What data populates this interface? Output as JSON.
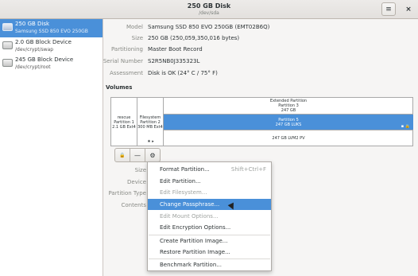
{
  "window": {
    "title": "250 GB Disk",
    "subtitle": "/dev/sda",
    "menu_icon": "hamburger-menu-icon",
    "close_icon": "close-icon"
  },
  "sidebar": {
    "items": [
      {
        "name": "250 GB Disk",
        "sub": "Samsung SSD 850 EVO 250GB",
        "icon": "hard-disk-icon",
        "selected": true
      },
      {
        "name": "2.0 GB Block Device",
        "sub": "/dev/crypt/swap",
        "icon": "hard-disk-icon",
        "selected": false
      },
      {
        "name": "245 GB Block Device",
        "sub": "/dev/crypt/root",
        "icon": "hard-disk-icon",
        "selected": false
      }
    ]
  },
  "disk_info": {
    "model_label": "Model",
    "model_value": "Samsung SSD 850 EVO 250GB (EMT02B6Q)",
    "size_label": "Size",
    "size_value": "250 GB (250,059,350,016 bytes)",
    "partitioning_label": "Partitioning",
    "partitioning_value": "Master Boot Record",
    "serial_label": "Serial Number",
    "serial_value": "S2R5NB0J335323L",
    "assessment_label": "Assessment",
    "assessment_value": "Disk is OK (24° C / 75° F)"
  },
  "volumes": {
    "heading": "Volumes",
    "rescue": {
      "line1": "rescue",
      "line2": "Partition 1",
      "line3": "2.1 GB Ext4"
    },
    "filesystem": {
      "line1": "Filesystem",
      "line2": "Partition 2",
      "line3": "300 MB Ext4"
    },
    "extended": {
      "line1": "Extended Partition",
      "line2": "Partition 3",
      "line3": "247 GB"
    },
    "partition5": {
      "line1": "Partition 5",
      "line2": "247 GB LUKS"
    },
    "lvm": {
      "line1": "247 GB LVM2 PV"
    },
    "star_marker": "★ ▸",
    "small_icons": "▪ 🔒"
  },
  "volume_toolbar": {
    "lock_icon": "lock-icon",
    "minus_icon": "minus-icon",
    "gears_icon": "gears-icon",
    "lock_glyph": "🔒",
    "minus_glyph": "—",
    "gears_glyph": "⚙"
  },
  "volume_details": {
    "size_label": "Size",
    "device_label": "Device",
    "partition_type_label": "Partition Type",
    "contents_label": "Contents"
  },
  "menu": {
    "items": [
      {
        "label": "Format Partition...",
        "accel": "Shift+Ctrl+F",
        "state": "normal"
      },
      {
        "label": "Edit Partition...",
        "accel": "",
        "state": "normal"
      },
      {
        "label": "Edit Filesystem...",
        "accel": "",
        "state": "disabled"
      },
      {
        "label": "Change Passphrase...",
        "accel": "",
        "state": "highlight"
      },
      {
        "label": "Edit Mount Options...",
        "accel": "",
        "state": "disabled"
      },
      {
        "label": "Edit Encryption Options...",
        "accel": "",
        "state": "normal"
      },
      {
        "label": "Create Partition Image...",
        "accel": "",
        "state": "normal"
      },
      {
        "label": "Restore Partition Image...",
        "accel": "",
        "state": "normal"
      },
      {
        "label": "Benchmark Partition...",
        "accel": "",
        "state": "normal"
      }
    ]
  },
  "colors": {
    "accent": "#4a90d9",
    "background": "#f6f5f4",
    "disabled_text": "#9fa3a0"
  }
}
